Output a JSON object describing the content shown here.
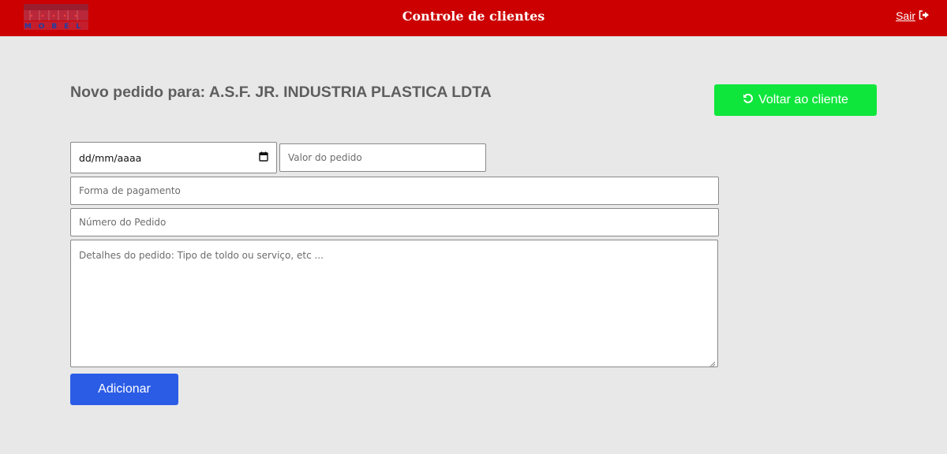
{
  "header": {
    "title": "Controle de clientes",
    "logout_label": "Sair",
    "logout_icon": "sign-out-icon",
    "logo_icon": "mobel-logo",
    "logo_text": "MOBEL"
  },
  "page": {
    "title": "Novo pedido para: A.S.F. JR. INDUSTRIA PLASTICA LDTA",
    "back_button": {
      "label": "Voltar ao cliente",
      "icon": "undo-icon"
    }
  },
  "form": {
    "date_placeholder": "dd/mm/aaaa",
    "date_icon": "calendar-icon",
    "valor_placeholder": "Valor do pedido",
    "forma_placeholder": "Forma de pagamento",
    "numero_placeholder": "Número do Pedido",
    "detalhes_placeholder": "Detalhes do pedido: Tipo de toldo ou serviço, etc ...",
    "submit_label": "Adicionar"
  },
  "colors": {
    "header_bg": "#cc0000",
    "page_bg": "#e8e8e8",
    "back_button_bg": "#0fe63c",
    "submit_button_bg": "#2b5ce6",
    "title_text": "#5e5e5e"
  }
}
